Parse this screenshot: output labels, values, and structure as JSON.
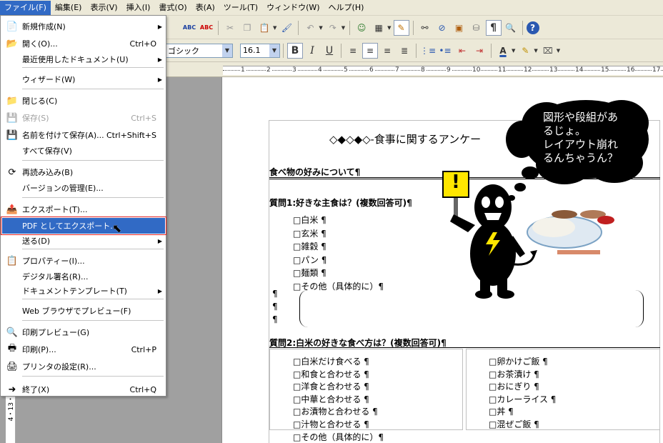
{
  "menubar": {
    "items": [
      "ファイル(F)",
      "編集(E)",
      "表示(V)",
      "挿入(I)",
      "書式(O)",
      "表(A)",
      "ツール(T)",
      "ウィンドウ(W)",
      "ヘルプ(H)"
    ]
  },
  "file_menu": {
    "items": [
      {
        "label": "新規作成(N)",
        "shortcut": "",
        "submenu": true,
        "icon": "new-document-icon",
        "disabled": false
      },
      {
        "label": "開く(O)...",
        "shortcut": "Ctrl+O",
        "submenu": false,
        "icon": "open-folder-icon",
        "disabled": false
      },
      {
        "label": "最近使用したドキュメント(U)",
        "shortcut": "",
        "submenu": true,
        "icon": "",
        "disabled": false
      },
      {
        "label": "ウィザード(W)",
        "shortcut": "",
        "submenu": true,
        "icon": "",
        "disabled": false
      },
      {
        "label": "閉じる(C)",
        "shortcut": "",
        "submenu": false,
        "icon": "close-document-icon",
        "disabled": false
      },
      {
        "label": "保存(S)",
        "shortcut": "Ctrl+S",
        "submenu": false,
        "icon": "save-icon",
        "disabled": true
      },
      {
        "label": "名前を付けて保存(A)...",
        "shortcut": "Ctrl+Shift+S",
        "submenu": false,
        "icon": "save-as-icon",
        "disabled": false
      },
      {
        "label": "すべて保存(V)",
        "shortcut": "",
        "submenu": false,
        "icon": "",
        "disabled": false
      },
      {
        "label": "再読み込み(B)",
        "shortcut": "",
        "submenu": false,
        "icon": "reload-icon",
        "disabled": false
      },
      {
        "label": "バージョンの管理(E)...",
        "shortcut": "",
        "submenu": false,
        "icon": "",
        "disabled": false
      },
      {
        "label": "エクスポート(T)...",
        "shortcut": "",
        "submenu": false,
        "icon": "export-icon",
        "disabled": false
      },
      {
        "label": "PDF としてエクスポート...",
        "shortcut": "",
        "submenu": false,
        "icon": "",
        "disabled": false
      },
      {
        "label": "送る(D)",
        "shortcut": "",
        "submenu": true,
        "icon": "",
        "disabled": false
      },
      {
        "label": "プロパティー(I)...",
        "shortcut": "",
        "submenu": false,
        "icon": "properties-icon",
        "disabled": false
      },
      {
        "label": "デジタル署名(R)...",
        "shortcut": "",
        "submenu": false,
        "icon": "",
        "disabled": false
      },
      {
        "label": "ドキュメントテンプレート(T)",
        "shortcut": "",
        "submenu": true,
        "icon": "",
        "disabled": false
      },
      {
        "label": "Web ブラウザでプレビュー(F)",
        "shortcut": "",
        "submenu": false,
        "icon": "",
        "disabled": false
      },
      {
        "label": "印刷プレビュー(G)",
        "shortcut": "",
        "submenu": false,
        "icon": "print-preview-icon",
        "disabled": false
      },
      {
        "label": "印刷(P)...",
        "shortcut": "Ctrl+P",
        "submenu": false,
        "icon": "printer-icon",
        "disabled": false
      },
      {
        "label": "プリンタの設定(R)...",
        "shortcut": "",
        "submenu": false,
        "icon": "printer-settings-icon",
        "disabled": false
      },
      {
        "label": "終了(X)",
        "shortcut": "Ctrl+Q",
        "submenu": false,
        "icon": "exit-icon",
        "disabled": false
      }
    ]
  },
  "toolbar": {
    "font_name": "ゴシック",
    "font_size": "16.1",
    "bold": "B",
    "italic": "I",
    "underline": "U",
    "paragraph_mark": "¶",
    "help": "?"
  },
  "ruler": {
    "numbers": [
      "1",
      "2",
      "3",
      "4",
      "5",
      "6",
      "7",
      "8",
      "9",
      "10",
      "11",
      "12",
      "13",
      "14",
      "15",
      "16",
      "17"
    ]
  },
  "vertical_ruler": {
    "text": "4・13・"
  },
  "document": {
    "title": "◇◆◇◆◇-食事に関するアンケー",
    "section_heading": "食べ物の好みについて¶",
    "q1": "質問1:好きな主食は？(複数回答可)¶",
    "q1_options": [
      "□白米 ¶",
      "□玄米 ¶",
      "□雑穀 ¶",
      "□パン ¶",
      "□麺類 ¶",
      "□その他（具体的に）¶"
    ],
    "empty_paras": [
      "¶",
      "¶",
      "¶"
    ],
    "q2": "質問2:白米の好きな食べ方は？(複数回答可)¶",
    "q2_left": [
      "□白米だけ食べる ¶",
      "□和食と合わせる ¶",
      "□洋食と合わせる ¶",
      "□中華と合わせる ¶",
      "□お漬物と合わせる ¶",
      "□汁物と合わせる ¶",
      "□その他（具体的に）¶"
    ],
    "q2_right": [
      "□卵かけご飯 ¶",
      "□お茶漬け ¶",
      "□おにぎり ¶",
      "□カレーライス ¶",
      "□丼 ¶",
      "□混ぜご飯 ¶"
    ]
  },
  "callout": {
    "lines": [
      "図形や段組があ",
      "るじょ。",
      "レイアウト崩れ",
      "るんちゃうん？"
    ],
    "sign": "!"
  }
}
